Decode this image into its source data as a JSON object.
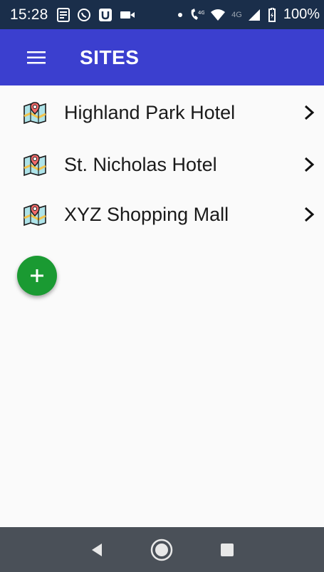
{
  "status_bar": {
    "time": "15:28",
    "battery": "100%",
    "network_label": "4G",
    "icons": [
      "news-icon",
      "whatsapp-icon",
      "u-app-icon",
      "video-icon",
      "dot-icon",
      "wifi-call-icon",
      "wifi-icon",
      "signal-icon",
      "battery-charging-icon"
    ]
  },
  "app_bar": {
    "title": "SITES",
    "menu_icon": "hamburger-menu-icon"
  },
  "sites": [
    {
      "label": "Highland Park Hotel",
      "icon": "site-map-icon"
    },
    {
      "label": "St. Nicholas Hotel",
      "icon": "site-map-icon"
    },
    {
      "label": "XYZ Shopping Mall",
      "icon": "site-map-icon"
    }
  ],
  "fab": {
    "icon": "plus-icon"
  },
  "nav_bar": {
    "buttons": [
      "back-icon",
      "home-icon",
      "recents-icon"
    ]
  },
  "colors": {
    "status_bar": "#1a2e4a",
    "app_bar": "#3b3fcf",
    "fab": "#1a9a32",
    "nav_bar": "#4a5058",
    "background": "#fafafa"
  }
}
